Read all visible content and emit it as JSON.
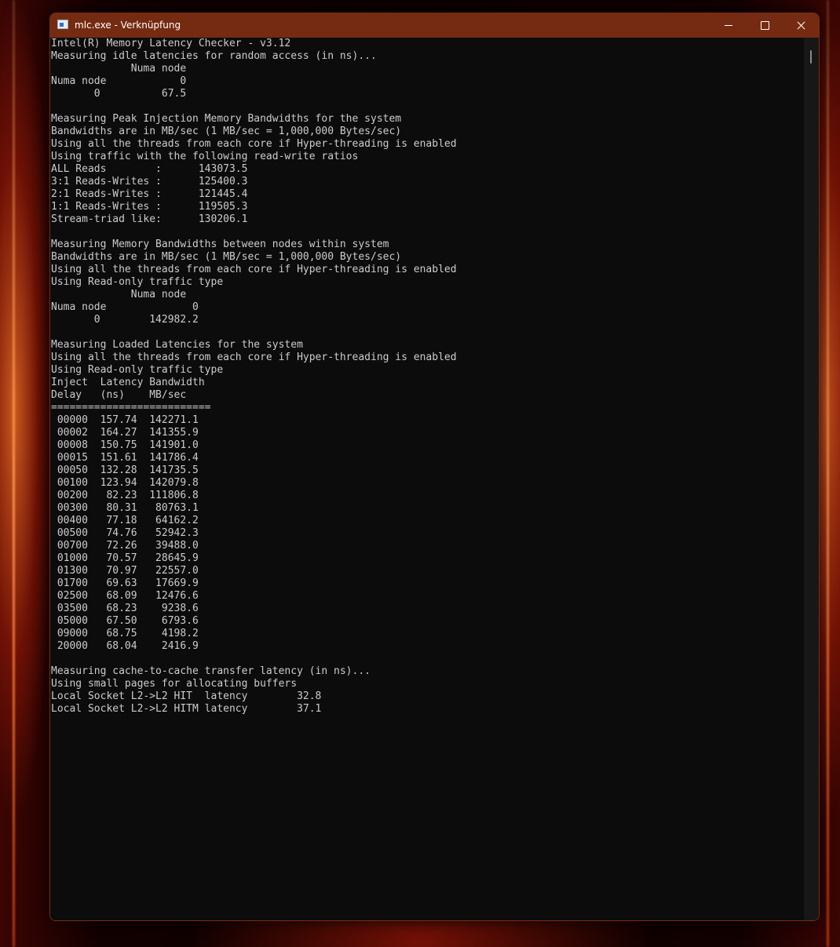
{
  "window": {
    "title": "mlc.exe - Verknüpfung"
  },
  "console": {
    "lines": [
      "Intel(R) Memory Latency Checker - v3.12",
      "Measuring idle latencies for random access (in ns)...",
      "             Numa node",
      "Numa node            0",
      "       0          67.5",
      "",
      "Measuring Peak Injection Memory Bandwidths for the system",
      "Bandwidths are in MB/sec (1 MB/sec = 1,000,000 Bytes/sec)",
      "Using all the threads from each core if Hyper-threading is enabled",
      "Using traffic with the following read-write ratios",
      "ALL Reads        :      143073.5",
      "3:1 Reads-Writes :      125400.3",
      "2:1 Reads-Writes :      121445.4",
      "1:1 Reads-Writes :      119505.3",
      "Stream-triad like:      130206.1",
      "",
      "Measuring Memory Bandwidths between nodes within system",
      "Bandwidths are in MB/sec (1 MB/sec = 1,000,000 Bytes/sec)",
      "Using all the threads from each core if Hyper-threading is enabled",
      "Using Read-only traffic type",
      "             Numa node",
      "Numa node              0",
      "       0        142982.2",
      "",
      "Measuring Loaded Latencies for the system",
      "Using all the threads from each core if Hyper-threading is enabled",
      "Using Read-only traffic type",
      "Inject  Latency Bandwidth",
      "Delay   (ns)    MB/sec",
      "==========================",
      " 00000  157.74  142271.1",
      " 00002  164.27  141355.9",
      " 00008  150.75  141901.0",
      " 00015  151.61  141786.4",
      " 00050  132.28  141735.5",
      " 00100  123.94  142079.8",
      " 00200   82.23  111806.8",
      " 00300   80.31   80763.1",
      " 00400   77.18   64162.2",
      " 00500   74.76   52942.3",
      " 00700   72.26   39488.0",
      " 01000   70.57   28645.9",
      " 01300   70.97   22557.0",
      " 01700   69.63   17669.9",
      " 02500   68.09   12476.6",
      " 03500   68.23    9238.6",
      " 05000   67.50    6793.6",
      " 09000   68.75    4198.2",
      " 20000   68.04    2416.9",
      "",
      "Measuring cache-to-cache transfer latency (in ns)...",
      "Using small pages for allocating buffers",
      "Local Socket L2->L2 HIT  latency        32.8",
      "Local Socket L2->L2 HITM latency        37.1"
    ]
  },
  "icons": {
    "app": "console-app-icon",
    "minimize": "minimize-icon",
    "maximize": "maximize-icon",
    "close": "close-icon"
  },
  "colors": {
    "titlebar": "#752b11",
    "console_bg": "#0c0c0c",
    "console_text": "#cccccc"
  }
}
